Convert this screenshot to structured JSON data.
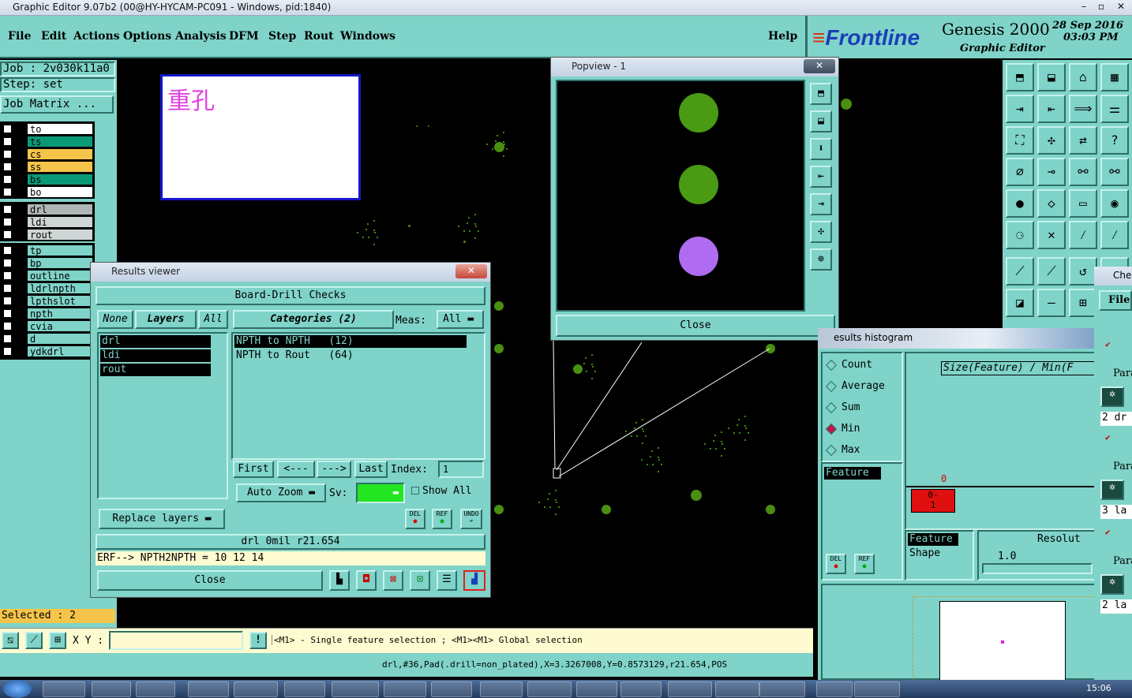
{
  "window": {
    "title": "Graphic Editor 9.07b2 (00@HY-HYCAM-PC091 - Windows, pid:1840)"
  },
  "menu": [
    "File",
    "Edit",
    "Actions",
    "Options",
    "Analysis",
    "DFM",
    "Step",
    "Rout",
    "Windows"
  ],
  "help": "Help",
  "brand": {
    "logo": "Frontline",
    "product": "Genesis 2000",
    "subtitle": "Graphic Editor",
    "date": "28 Sep 2016",
    "time": "03:03 PM"
  },
  "left": {
    "job": "Job : 2v030k11a0",
    "step": "Step: set",
    "job_matrix": "Job Matrix ...",
    "layers_group1": [
      {
        "name": "to",
        "color": "#ffffff"
      },
      {
        "name": "ts",
        "color": "#0b9a78"
      },
      {
        "name": "cs",
        "color": "#f5c44a"
      },
      {
        "name": "ss",
        "color": "#f5c44a"
      },
      {
        "name": "bs",
        "color": "#0b9a78"
      },
      {
        "name": "bo",
        "color": "#ffffff"
      }
    ],
    "layers_group2": [
      {
        "name": "drl",
        "color": "#aeb6b6"
      },
      {
        "name": "ldi",
        "color": "#cfd6d6"
      },
      {
        "name": "rout",
        "color": "#cfd6d6"
      }
    ],
    "layers_group3": [
      {
        "name": "tp",
        "color": "#7fd3c8"
      },
      {
        "name": "bp",
        "color": "#7fd3c8"
      },
      {
        "name": "outline",
        "color": "#7fd3c8"
      },
      {
        "name": "ldrlnpth",
        "color": "#7fd3c8"
      },
      {
        "name": "lpthslot",
        "color": "#7fd3c8"
      },
      {
        "name": "npth",
        "color": "#7fd3c8"
      },
      {
        "name": "cvia",
        "color": "#7fd3c8"
      },
      {
        "name": "d",
        "color": "#7fd3c8"
      },
      {
        "name": "ydkdrl",
        "color": "#7fd3c8"
      }
    ],
    "selected": "Selected : 2"
  },
  "note_box": {
    "text": "重孔"
  },
  "results": {
    "title": "Results viewer",
    "header": "Board-Drill Checks",
    "none": "None",
    "layers": "Layers",
    "all": "All",
    "categories": "Categories (2)",
    "meas_label": "Meas:",
    "meas_value": "All",
    "layer_list": [
      "drl",
      "ldi",
      "rout"
    ],
    "category_list": [
      "NPTH to NPTH   (12)",
      "NPTH to Rout   (64)"
    ],
    "first": "First",
    "prev": "<---",
    "next": "--->",
    "last": "Last",
    "index_label": "Index:",
    "index_value": "1",
    "auto_zoom": "Auto Zoom",
    "sv_label": "Sv:",
    "show_all": "Show All",
    "replace_layers": "Replace layers",
    "del": "DEL",
    "ref": "REF",
    "undo": "UNDO",
    "info": "drl  0mil   r21.654",
    "erf": "ERF--> NPTH2NPTH = 10 12 14",
    "close": "Close"
  },
  "popview": {
    "title": "Popview - 1",
    "close": "Close"
  },
  "histogram": {
    "title": "esults histogram",
    "stats": [
      "Count",
      "Average",
      "Sum",
      "Min",
      "Max"
    ],
    "selected_stat": "Min",
    "feature_label": "Feature",
    "size_label": "Size(Feature) / Min(F",
    "bar_top": "0",
    "bar_label": "0-\n1",
    "feature2": "Feature",
    "shape": "Shape",
    "resolution": "Resolut",
    "res_value": "1.0",
    "del": "DEL",
    "ref": "REF"
  },
  "checklist": {
    "title": "Che",
    "file": "File",
    "para": "Para",
    "rows": [
      "2 dr",
      "3 la",
      "2 la"
    ]
  },
  "status": {
    "xy_label": "X Y :",
    "hint": "<M1> - Single feature selection ; <M1><M1> Global selection",
    "feature_info": "drl,#36,Pad(.drill=non_plated),X=3.3267008,Y=0.8573129,r21.654,POS",
    "clock": "15:06"
  }
}
